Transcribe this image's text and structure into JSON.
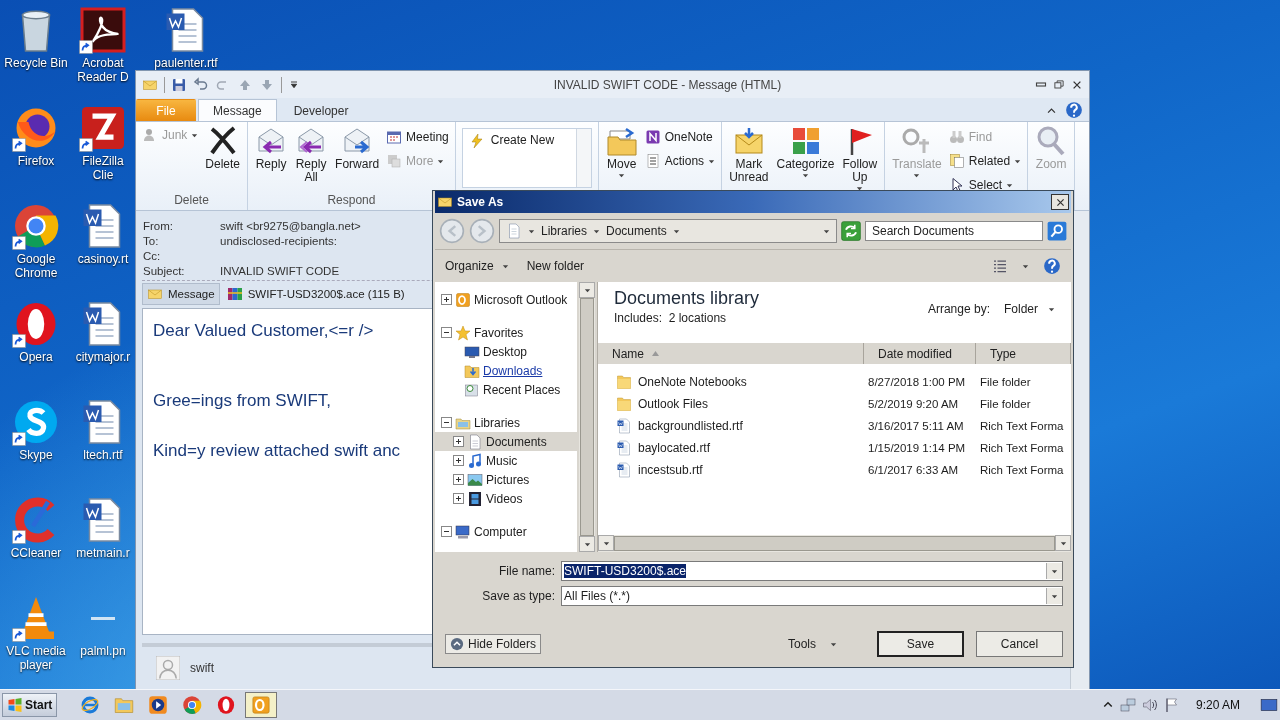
{
  "desktop_columns": [
    [
      {
        "label": "Recycle Bin",
        "kind": "recycle",
        "shortcut": false
      },
      {
        "label": "Firefox",
        "kind": "firefox",
        "shortcut": true
      },
      {
        "label": "Google Chrome",
        "kind": "chrome",
        "shortcut": true
      },
      {
        "label": "Opera",
        "kind": "opera",
        "shortcut": true
      },
      {
        "label": "Skype",
        "kind": "skype",
        "shortcut": true
      },
      {
        "label": "CCleaner",
        "kind": "ccleaner",
        "shortcut": true
      },
      {
        "label": "VLC media player",
        "kind": "vlc",
        "shortcut": true
      }
    ],
    [
      {
        "label": "Acrobat Reader D",
        "kind": "pdf",
        "shortcut": true
      },
      {
        "label": "FileZilla Clie",
        "kind": "filezilla",
        "shortcut": true
      },
      {
        "label": "casinoy.rt",
        "kind": "doc",
        "shortcut": false
      },
      {
        "label": "citymajor.r",
        "kind": "doc",
        "shortcut": false
      },
      {
        "label": "ltech.rtf",
        "kind": "doc",
        "shortcut": false
      },
      {
        "label": "metmain.r",
        "kind": "doc",
        "shortcut": false
      },
      {
        "label": "palml.pn",
        "kind": "blank",
        "shortcut": false
      }
    ],
    [
      {
        "label": "paulenter.rtf",
        "kind": "doc",
        "shortcut": false
      }
    ]
  ],
  "outlook": {
    "title": "INVALID SWIFT CODE - Message (HTML)",
    "tabs": [
      {
        "label": "File",
        "kind": "file",
        "selected": false
      },
      {
        "label": "Message",
        "kind": "tab",
        "selected": true
      },
      {
        "label": "Developer",
        "kind": "tab",
        "selected": false
      }
    ],
    "ribbon_groups": [
      {
        "label": "Delete",
        "items": [
          {
            "kind": "small",
            "label": "Junk",
            "disabled": true,
            "caret": true
          },
          {
            "kind": "large",
            "label": "Delete",
            "disabled": false,
            "caret": false
          }
        ]
      },
      {
        "label": "Respond",
        "items": [
          {
            "kind": "large",
            "label": "Reply",
            "disabled": false,
            "caret": false
          },
          {
            "kind": "large",
            "label": "Reply All",
            "disabled": false,
            "caret": false
          },
          {
            "kind": "large",
            "label": "Forward",
            "disabled": false,
            "caret": false
          },
          {
            "kind": "stack",
            "items": [
              {
                "label": "Meeting",
                "disabled": false,
                "caret": false
              },
              {
                "label": "More",
                "disabled": true,
                "caret": true
              }
            ]
          }
        ]
      },
      {
        "items": [
          {
            "kind": "gallery",
            "label": "Create New"
          }
        ]
      },
      {
        "items": [
          {
            "kind": "large",
            "label": "Move",
            "disabled": false,
            "caret": true
          },
          {
            "kind": "stack",
            "items": [
              {
                "label": "OneNote",
                "disabled": false,
                "caret": false
              },
              {
                "label": "Actions",
                "disabled": false,
                "caret": true
              }
            ]
          }
        ]
      },
      {
        "items": [
          {
            "kind": "large",
            "label": "Mark Unread",
            "disabled": false,
            "caret": false
          },
          {
            "kind": "large",
            "label": "Categorize",
            "disabled": false,
            "caret": true
          },
          {
            "kind": "large",
            "label": "Follow Up",
            "disabled": false,
            "caret": true
          }
        ]
      },
      {
        "items": [
          {
            "kind": "large",
            "label": "Translate",
            "disabled": true,
            "caret": true
          },
          {
            "kind": "stack",
            "items": [
              {
                "label": "Find",
                "disabled": true,
                "caret": false
              },
              {
                "label": "Related",
                "disabled": false,
                "caret": true
              },
              {
                "label": "Select",
                "disabled": false,
                "caret": true
              }
            ]
          }
        ]
      },
      {
        "items": [
          {
            "kind": "large",
            "label": "Zoom",
            "disabled": true,
            "caret": false
          }
        ]
      }
    ],
    "header": [
      {
        "label": "From:",
        "value": "swift <br9275@bangla.net>"
      },
      {
        "label": "To:",
        "value": "undisclosed-recipients:"
      },
      {
        "label": "Cc:"
      },
      {
        "label": "Subject:",
        "value": "INVALID SWIFT CODE"
      }
    ],
    "attachments": [
      {
        "label": "Message",
        "kind": "message",
        "selected": true
      },
      {
        "label": "SWIFT-USD3200$.ace (115 B)",
        "kind": "archive",
        "selected": false
      }
    ],
    "body": [
      "Dear Valued Customer,<=r />",
      "Gree=ings from SWIFT,",
      "Kind=y review attached swift anc"
    ],
    "people_pane": {
      "name": "swift"
    }
  },
  "save_as": {
    "title": "Save As",
    "breadcrumb": [
      "Libraries",
      "Documents"
    ],
    "search": {
      "placeholder": "Search Documents"
    },
    "toolbar": [
      {
        "label": "Organize",
        "caret": true
      },
      {
        "label": "New folder",
        "caret": false
      }
    ],
    "nav_tree": [
      {
        "label": "Microsoft Outlook",
        "kind": "outlook",
        "expanded": false,
        "selected": false,
        "hovered": false
      },
      {
        "label": "Favorites",
        "kind": "star",
        "expanded": true,
        "selected": false,
        "hovered": false,
        "children": [
          {
            "label": "Desktop",
            "kind": "desktop",
            "selected": false,
            "hovered": false
          },
          {
            "label": "Downloads",
            "kind": "downloads",
            "selected": false,
            "hovered": true
          },
          {
            "label": "Recent Places",
            "kind": "recent",
            "selected": false,
            "hovered": false
          }
        ]
      },
      {
        "label": "Libraries",
        "kind": "libraries",
        "expanded": true,
        "selected": false,
        "hovered": false,
        "children": [
          {
            "label": "Documents",
            "kind": "documents",
            "expanded": false,
            "selected": true,
            "hovered": false
          },
          {
            "label": "Music",
            "kind": "music",
            "expanded": false,
            "selected": false,
            "hovered": false
          },
          {
            "label": "Pictures",
            "kind": "pictures",
            "expanded": false,
            "selected": false,
            "hovered": false
          },
          {
            "label": "Videos",
            "kind": "videos",
            "expanded": false,
            "selected": false,
            "hovered": false
          }
        ]
      },
      {
        "label": "Computer",
        "kind": "computer",
        "expanded": true,
        "selected": false,
        "hovered": false
      }
    ],
    "library": {
      "title": "Documents library",
      "includes": "Includes:  2 locations",
      "arrange_label": "Arrange by:",
      "arrange_value": "Folder"
    },
    "columns": [
      {
        "label": "Name",
        "sorted": true
      },
      {
        "label": "Date modified",
        "sorted": false
      },
      {
        "label": "Type",
        "sorted": false
      }
    ],
    "files": [
      {
        "name": "OneNote Notebooks",
        "date": "8/27/2018 1:00 PM",
        "type": "File folder",
        "kind": "folder"
      },
      {
        "name": "Outlook Files",
        "date": "5/2/2019 9:20 AM",
        "type": "File folder",
        "kind": "folder"
      },
      {
        "name": "backgroundlisted.rtf",
        "date": "3/16/2017 5:11 AM",
        "type": "Rich Text Forma",
        "kind": "doc"
      },
      {
        "name": "baylocated.rtf",
        "date": "1/15/2019 1:14 PM",
        "type": "Rich Text Forma",
        "kind": "doc"
      },
      {
        "name": "incestsub.rtf",
        "date": "6/1/2017 6:33 AM",
        "type": "Rich Text Forma",
        "kind": "doc"
      }
    ],
    "file_name": {
      "label": "File name:",
      "value": "SWIFT-USD3200$.ace"
    },
    "save_type": {
      "label": "Save as type:",
      "value": "All Files (*.*)"
    },
    "hide_folders": "Hide Folders",
    "tools": "Tools",
    "buttons": [
      {
        "label": "Save",
        "default": true
      },
      {
        "label": "Cancel",
        "default": false
      }
    ]
  },
  "taskbar": {
    "start": "Start",
    "items": [
      {
        "kind": "ie",
        "active": false
      },
      {
        "kind": "explorer",
        "active": false
      },
      {
        "kind": "media",
        "active": false
      },
      {
        "kind": "chrome",
        "active": false
      },
      {
        "kind": "opera",
        "active": false
      },
      {
        "kind": "outlook",
        "active": true
      }
    ],
    "clock": "9:20 AM"
  }
}
